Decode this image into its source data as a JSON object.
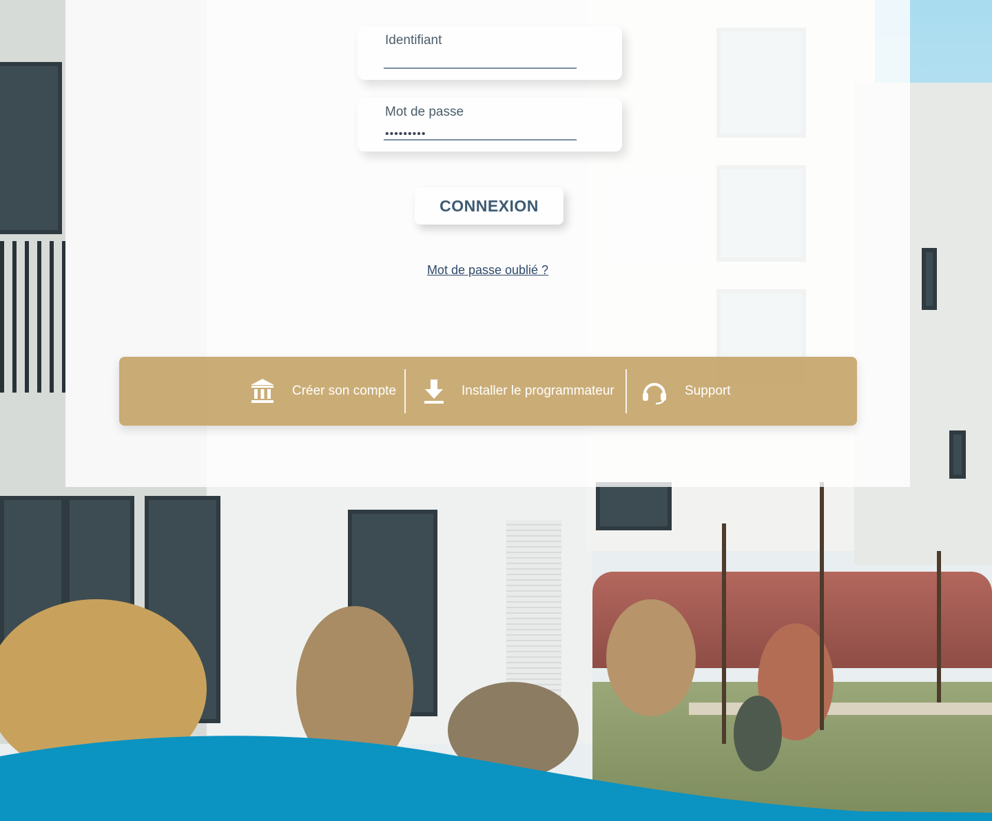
{
  "login": {
    "username_label": "Identifiant",
    "username_value": "",
    "password_label": "Mot de passe",
    "password_value": "•••••••••",
    "submit_label": "CONNEXION",
    "forgot_label": "Mot de passe oublié ?"
  },
  "actions_bar": {
    "items": [
      {
        "label": "Créer son compte",
        "icon": "bank-icon"
      },
      {
        "label": "Installer le programmateur",
        "icon": "download-icon"
      },
      {
        "label": "Support",
        "icon": "headset-icon"
      }
    ]
  },
  "colors": {
    "accent_gold": "#c19e60",
    "wave_blue": "#0b93c2",
    "text_dark_blue": "#3d5a73"
  }
}
